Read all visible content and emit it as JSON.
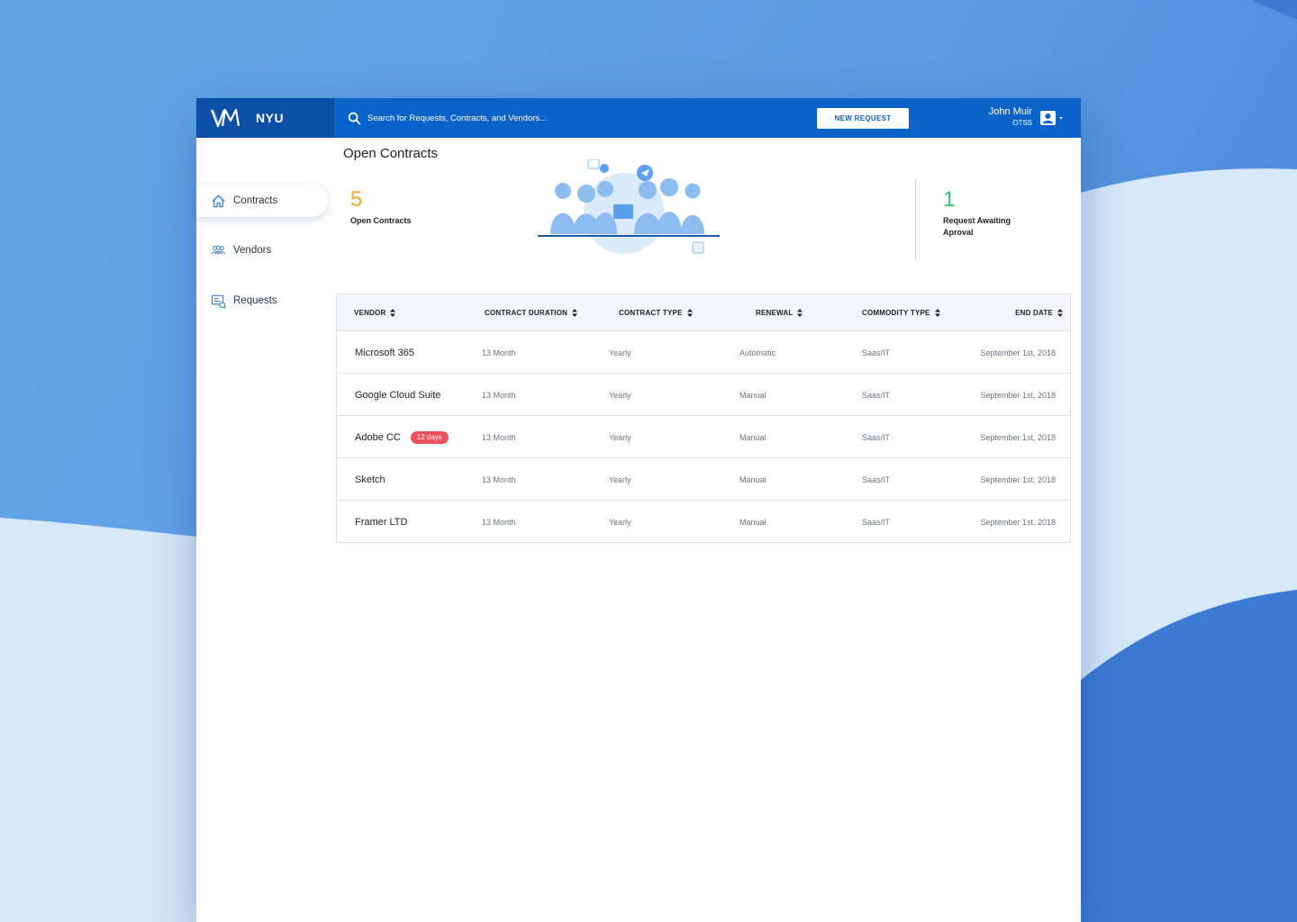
{
  "topbar": {
    "brand_logo": "VM",
    "brand_name": "NYU",
    "search_placeholder": "Search for Requests, Contracts, and Vendors...",
    "new_request_label": "NEW REQUEST",
    "user_name": "John Muir",
    "user_dept": "OTSS"
  },
  "sidebar": {
    "items": [
      {
        "label": "Contracts",
        "icon": "home-icon",
        "active": true
      },
      {
        "label": "Vendors",
        "icon": "people-icon",
        "active": false
      },
      {
        "label": "Requests",
        "icon": "requests-icon",
        "active": false
      }
    ]
  },
  "main": {
    "title": "Open Contracts",
    "stats": [
      {
        "value": "5",
        "label": "Open Contracts",
        "color": "#f5a623"
      },
      {
        "value": "1",
        "label": "Request Awaiting Aproval",
        "color": "#2ecc71"
      }
    ]
  },
  "table": {
    "columns": [
      "VENDOR",
      "CONTRACT DURATION",
      "CONTRACT TYPE",
      "RENEWAL",
      "COMMODITY TYPE",
      "END DATE"
    ],
    "rows": [
      {
        "vendor": "Microsoft 365",
        "badge": "",
        "duration": "13 Month",
        "type": "Yearly",
        "renewal": "Automatic",
        "commodity": "Saas/IT",
        "end_date": "September 1st, 2018"
      },
      {
        "vendor": "Google Cloud Suite",
        "badge": "",
        "duration": "13 Month",
        "type": "Yearly",
        "renewal": "Manual",
        "commodity": "Saas/IT",
        "end_date": "September 1st, 2018"
      },
      {
        "vendor": "Adobe CC",
        "badge": "12 days",
        "duration": "13 Month",
        "type": "Yearly",
        "renewal": "Manual",
        "commodity": "Saas/IT",
        "end_date": "September 1st, 2018"
      },
      {
        "vendor": "Sketch",
        "badge": "",
        "duration": "13 Month",
        "type": "Yearly",
        "renewal": "Manual",
        "commodity": "Saas/IT",
        "end_date": "September 1st, 2018"
      },
      {
        "vendor": "Framer LTD",
        "badge": "",
        "duration": "13 Month",
        "type": "Yearly",
        "renewal": "Manual",
        "commodity": "Saas/IT",
        "end_date": "September 1st, 2018"
      }
    ]
  },
  "colors": {
    "brand_dark": "#0b4fa6",
    "topbar": "#0a63c9",
    "badge": "#f0505a",
    "accent_orange": "#f5a623",
    "accent_green": "#2ecc71"
  }
}
